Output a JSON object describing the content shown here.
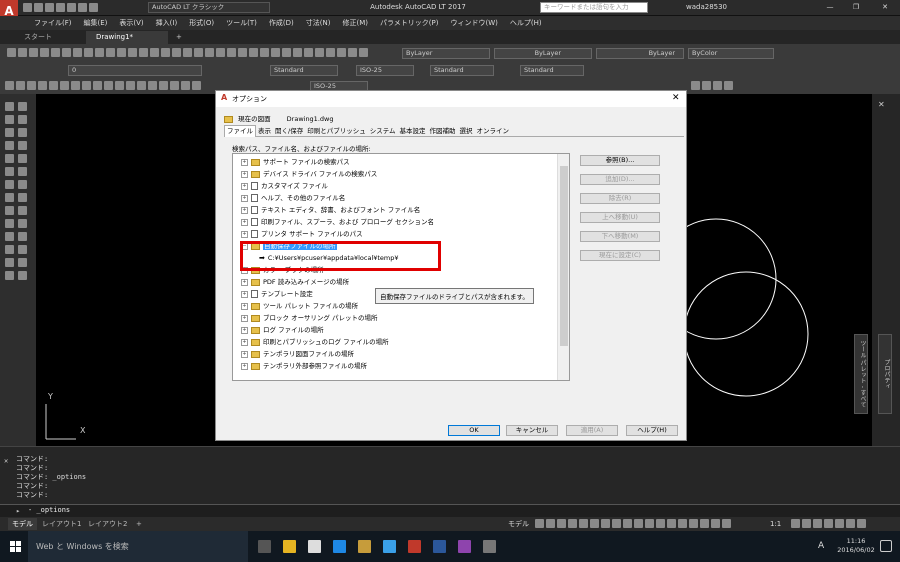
{
  "app": {
    "workspace": "AutoCAD LT クラシック",
    "title": "Autodesk AutoCAD LT 2017",
    "search_placeholder": "キーワードまたは語句を入力",
    "user": "wada28530",
    "win_close": "✕",
    "win_restore": "❐",
    "win_min": "—"
  },
  "menu": [
    "ファイル(F)",
    "編集(E)",
    "表示(V)",
    "挿入(I)",
    "形式(O)",
    "ツール(T)",
    "作成(D)",
    "寸法(N)",
    "修正(M)",
    "パラメトリック(P)",
    "ウィンドウ(W)",
    "ヘルプ(H)"
  ],
  "doc_tabs": {
    "start": "スタート",
    "drawing": "Drawing1*",
    "add": "+"
  },
  "ribbon": {
    "layer": "0",
    "bylayer1": "ByLayer",
    "bylayer2": "ByLayer",
    "bylayer3": "ByLayer",
    "bycolor": "ByColor",
    "text_style": "Standard",
    "dim_style": "ISO-25",
    "table_style": "Standard",
    "mleader_style": "Standard",
    "dim2": "ISO-25"
  },
  "dialog": {
    "title": "オプション",
    "current_profile_label": "現在の図面",
    "current_drawing": "Drawing1.dwg",
    "tabs": [
      "ファイル",
      "表示",
      "開く/保存",
      "印刷とパブリッシュ",
      "システム",
      "基本設定",
      "作図補助",
      "選択",
      "オンライン"
    ],
    "tree_label": "検索パス、ファイル名、およびファイルの場所:",
    "items": [
      "サポート ファイルの検索パス",
      "デバイス ドライバ ファイルの検索パス",
      "カスタマイズ ファイル",
      "ヘルプ、その他のファイル名",
      "テキスト エディタ、辞書、およびフォント ファイル名",
      "印刷ファイル、スプーラ、および プロローグ セクション名",
      "プリンタ サポート ファイルのパス",
      "自動保存ファイルの場所",
      "C:¥Users¥pcuser¥appdata¥local¥temp¥",
      "カラー ブックの場所",
      "PDF 読み込みイメージの場所",
      "テンプレート設定",
      "ツール パレット ファイルの場所",
      "ブロック オーサリング パレットの場所",
      "ログ ファイルの場所",
      "印刷とパブリッシュのログ ファイルの場所",
      "テンポラリ図面ファイルの場所",
      "テンポラリ外部参照ファイルの場所"
    ],
    "tooltip": "自動保存ファイルのドライブとパスが含まれます。",
    "side_buttons": [
      "参照(B)...",
      "追加(D)...",
      "除去(R)",
      "上へ移動(U)",
      "下へ移動(M)",
      "現在に設定(C)"
    ],
    "ok": "OK",
    "cancel": "キャンセル",
    "apply": "適用(A)",
    "help": "ヘルプ(H)"
  },
  "axis": {
    "y": "Y",
    "x": "X"
  },
  "right_panel": "プロパティ",
  "right_panel2": "ツール パレット - すべて",
  "command_history": [
    "コマンド:",
    "コマンド:",
    "コマンド: _options",
    "コマンド:",
    "コマンド:"
  ],
  "command_input": "- _options",
  "layout_tabs": [
    "モデル",
    "レイアウト1",
    "レイアウト2",
    "+"
  ],
  "status": {
    "model": "モデル",
    "scale": "1:1"
  },
  "taskbar": {
    "search": "Web と Windows を検索",
    "ime": "A",
    "time": "11:16",
    "date": "2016/06/02"
  },
  "colors": {
    "accent": "#c0392b",
    "highlight_box": "#e00000",
    "selection": "#3399ff"
  }
}
